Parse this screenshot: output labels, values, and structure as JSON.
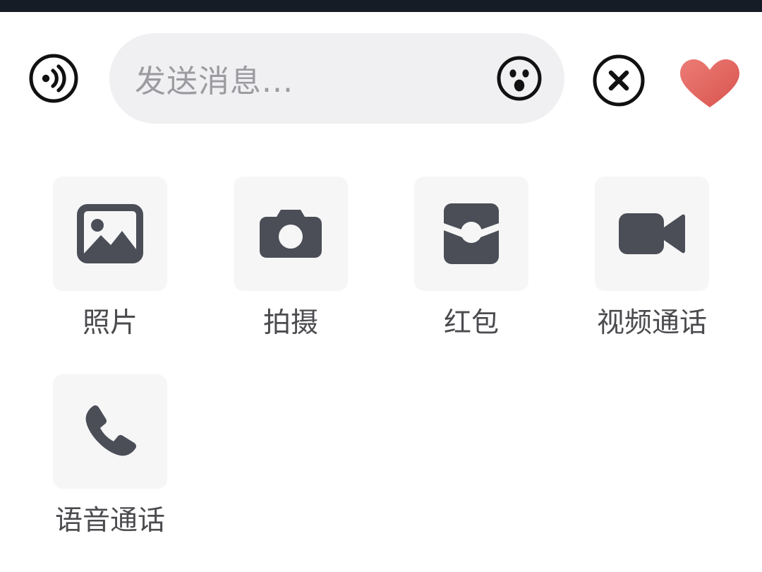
{
  "app": {
    "name": "chat-attachment-panel",
    "colors": {
      "status_bar": "#161c26",
      "background": "#ffffff",
      "input_field": "#f0f0f2",
      "tile": "#f6f6f7",
      "icon_dark": "#4b4e57",
      "icon_black": "#1b1b1b",
      "label_text": "#4b4b4f",
      "placeholder_text": "#9b9ba0",
      "heart_red": "#e1635f"
    }
  },
  "input_bar": {
    "voice_button": {
      "icon": "voice-wave-icon",
      "label": ""
    },
    "message_input": {
      "value": "",
      "placeholder": "发送消息...",
      "emoji_button": {
        "icon": "emoji-face-icon"
      }
    },
    "close_button": {
      "icon": "close-circle-icon"
    },
    "heart_button": {
      "icon": "heart-icon"
    }
  },
  "action_grid": {
    "rows": [
      [
        {
          "label": "照片",
          "icon": "photo-icon"
        },
        {
          "label": "拍摄",
          "icon": "camera-icon"
        },
        {
          "label": "红包",
          "icon": "red-packet-icon"
        },
        {
          "label": "视频通话",
          "icon": "video-call-icon"
        }
      ],
      [
        {
          "label": "语音通话",
          "icon": "voice-call-icon"
        }
      ]
    ]
  }
}
